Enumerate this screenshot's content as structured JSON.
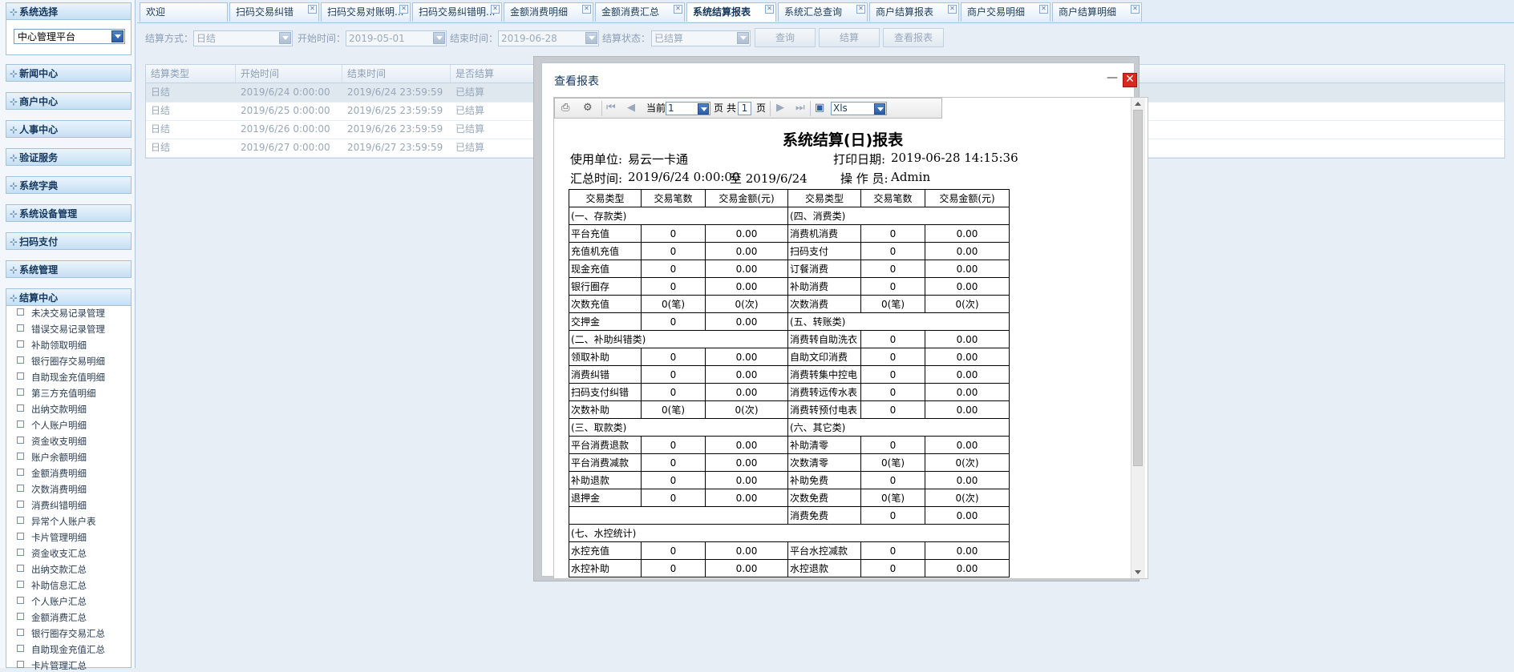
{
  "sidebar": {
    "system_select": {
      "header": "系统选择",
      "value": "中心管理平台"
    },
    "sections": [
      "新闻中心",
      "商户中心",
      "人事中心",
      "验证服务",
      "系统字典",
      "系统设备管理",
      "扫码支付",
      "系统管理",
      "结算中心"
    ],
    "tree_items": [
      "未决交易记录管理",
      "错误交易记录管理",
      "补助领取明细",
      "银行圈存交易明细",
      "自助现金充值明细",
      "第三方充值明细",
      "出纳交款明细",
      "个人账户明细",
      "资金收支明细",
      "账户余额明细",
      "金额消费明细",
      "次数消费明细",
      "消费纠错明细",
      "异常个人账户表",
      "卡片管理明细",
      "资金收支汇总",
      "出纳交款汇总",
      "补助信息汇总",
      "个人账户汇总",
      "金额消费汇总",
      "银行圈存交易汇总",
      "自助现金充值汇总",
      "卡片管理汇总"
    ]
  },
  "tabs": [
    {
      "label": "欢迎",
      "closable": false,
      "active": false
    },
    {
      "label": "扫码交易纠错",
      "closable": true,
      "active": false
    },
    {
      "label": "扫码交易对账明...",
      "closable": true,
      "active": false
    },
    {
      "label": "扫码交易纠错明...",
      "closable": true,
      "active": false
    },
    {
      "label": "金额消费明细",
      "closable": true,
      "active": false
    },
    {
      "label": "金额消费汇总",
      "closable": true,
      "active": false
    },
    {
      "label": "系统结算报表",
      "closable": true,
      "active": true
    },
    {
      "label": "系统汇总查询",
      "closable": true,
      "active": false
    },
    {
      "label": "商户结算报表",
      "closable": true,
      "active": false
    },
    {
      "label": "商户交易明细",
      "closable": true,
      "active": false
    },
    {
      "label": "商户结算明细",
      "closable": true,
      "active": false
    }
  ],
  "toolbar": {
    "settle_mode_label": "结算方式：",
    "settle_mode_value": "日结",
    "start_label": "开始时间：",
    "start_value": "2019-05-01",
    "end_label": "结束时间：",
    "end_value": "2019-06-28",
    "status_label": "结算状态：",
    "status_value": "已结算",
    "query_button": "查询",
    "settle_button": "结算",
    "view_report_button": "查看报表"
  },
  "grid": {
    "columns": [
      "结算类型",
      "开始时间",
      "结束时间",
      "是否结算"
    ],
    "rows": [
      [
        "日结",
        "2019/6/24 0:00:00",
        "2019/6/24 23:59:59",
        "已结算"
      ],
      [
        "日结",
        "2019/6/25 0:00:00",
        "2019/6/25 23:59:59",
        "已结算"
      ],
      [
        "日结",
        "2019/6/26 0:00:00",
        "2019/6/26 23:59:59",
        "已结算"
      ],
      [
        "日结",
        "2019/6/27 0:00:00",
        "2019/6/27 23:59:59",
        "已结算"
      ]
    ]
  },
  "modal": {
    "title": "查看报表",
    "minimize_glyph": "—",
    "close_glyph": "✕",
    "viewer": {
      "current_label": "当前",
      "current_page": "1",
      "page_unit": "页",
      "total_label": "共",
      "total_pages": "1",
      "export_format": "Xls"
    },
    "report": {
      "title": "系统结算(日)报表",
      "unit_label": "使用单位:",
      "unit_value": "易云一卡通",
      "print_date_label": "打印日期:",
      "print_date_value": "2019-06-28 14:15:36",
      "summary_label": "汇总时间:",
      "summary_from": "2019/6/24 0:00:00",
      "summary_to": "至 2019/6/24",
      "operator_label": "操 作 员:",
      "operator_value": "Admin",
      "headers": [
        "交易类型",
        "交易笔数",
        "交易金额(元)",
        "交易类型",
        "交易笔数",
        "交易金额(元)"
      ],
      "rows": [
        [
          {
            "t": "(一、存款类)",
            "span": 3
          },
          {
            "t": "(四、消费类)",
            "span": 3
          }
        ],
        [
          "平台充值",
          "0",
          "0.00",
          "消费机消费",
          "0",
          "0.00"
        ],
        [
          "充值机充值",
          "0",
          "0.00",
          "扫码支付",
          "0",
          "0.00"
        ],
        [
          "现金充值",
          "0",
          "0.00",
          "订餐消费",
          "0",
          "0.00"
        ],
        [
          "银行圈存",
          "0",
          "0.00",
          "补助消费",
          "0",
          "0.00"
        ],
        [
          "次数充值",
          "0(笔)",
          "0(次)",
          "次数消费",
          "0(笔)",
          "0(次)"
        ],
        [
          "交押金",
          "0",
          "0.00",
          {
            "t": "(五、转账类)",
            "span": 3
          }
        ],
        [
          {
            "t": "(二、补助纠错类)",
            "span": 3
          },
          "消费转自助洗衣",
          "0",
          "0.00"
        ],
        [
          "领取补助",
          "0",
          "0.00",
          "自助文印消费",
          "0",
          "0.00"
        ],
        [
          "消费纠错",
          "0",
          "0.00",
          "消费转集中控电",
          "0",
          "0.00"
        ],
        [
          "扫码支付纠错",
          "0",
          "0.00",
          "消费转远传水表",
          "0",
          "0.00"
        ],
        [
          "次数补助",
          "0(笔)",
          "0(次)",
          "消费转预付电表",
          "0",
          "0.00"
        ],
        [
          {
            "t": "(三、取款类)",
            "span": 3
          },
          {
            "t": "(六、其它类)",
            "span": 3
          }
        ],
        [
          "平台消费退款",
          "0",
          "0.00",
          "补助清零",
          "0",
          "0.00"
        ],
        [
          "平台消费减款",
          "0",
          "0.00",
          "次数清零",
          "0(笔)",
          "0(次)"
        ],
        [
          "补助退款",
          "0",
          "0.00",
          "补助免费",
          "0",
          "0.00"
        ],
        [
          "退押金",
          "0",
          "0.00",
          "次数免费",
          "0(笔)",
          "0(次)"
        ],
        [
          {
            "t": "",
            "span": 3,
            "blank": true
          },
          "消费免费",
          "0",
          "0.00"
        ],
        [
          {
            "t": "(七、水控统计)",
            "span": 6
          }
        ],
        [
          "水控充值",
          "0",
          "0.00",
          "平台水控减款",
          "0",
          "0.00"
        ],
        [
          "水控补助",
          "0",
          "0.00",
          "水控退款",
          "0",
          "0.00"
        ]
      ]
    }
  }
}
